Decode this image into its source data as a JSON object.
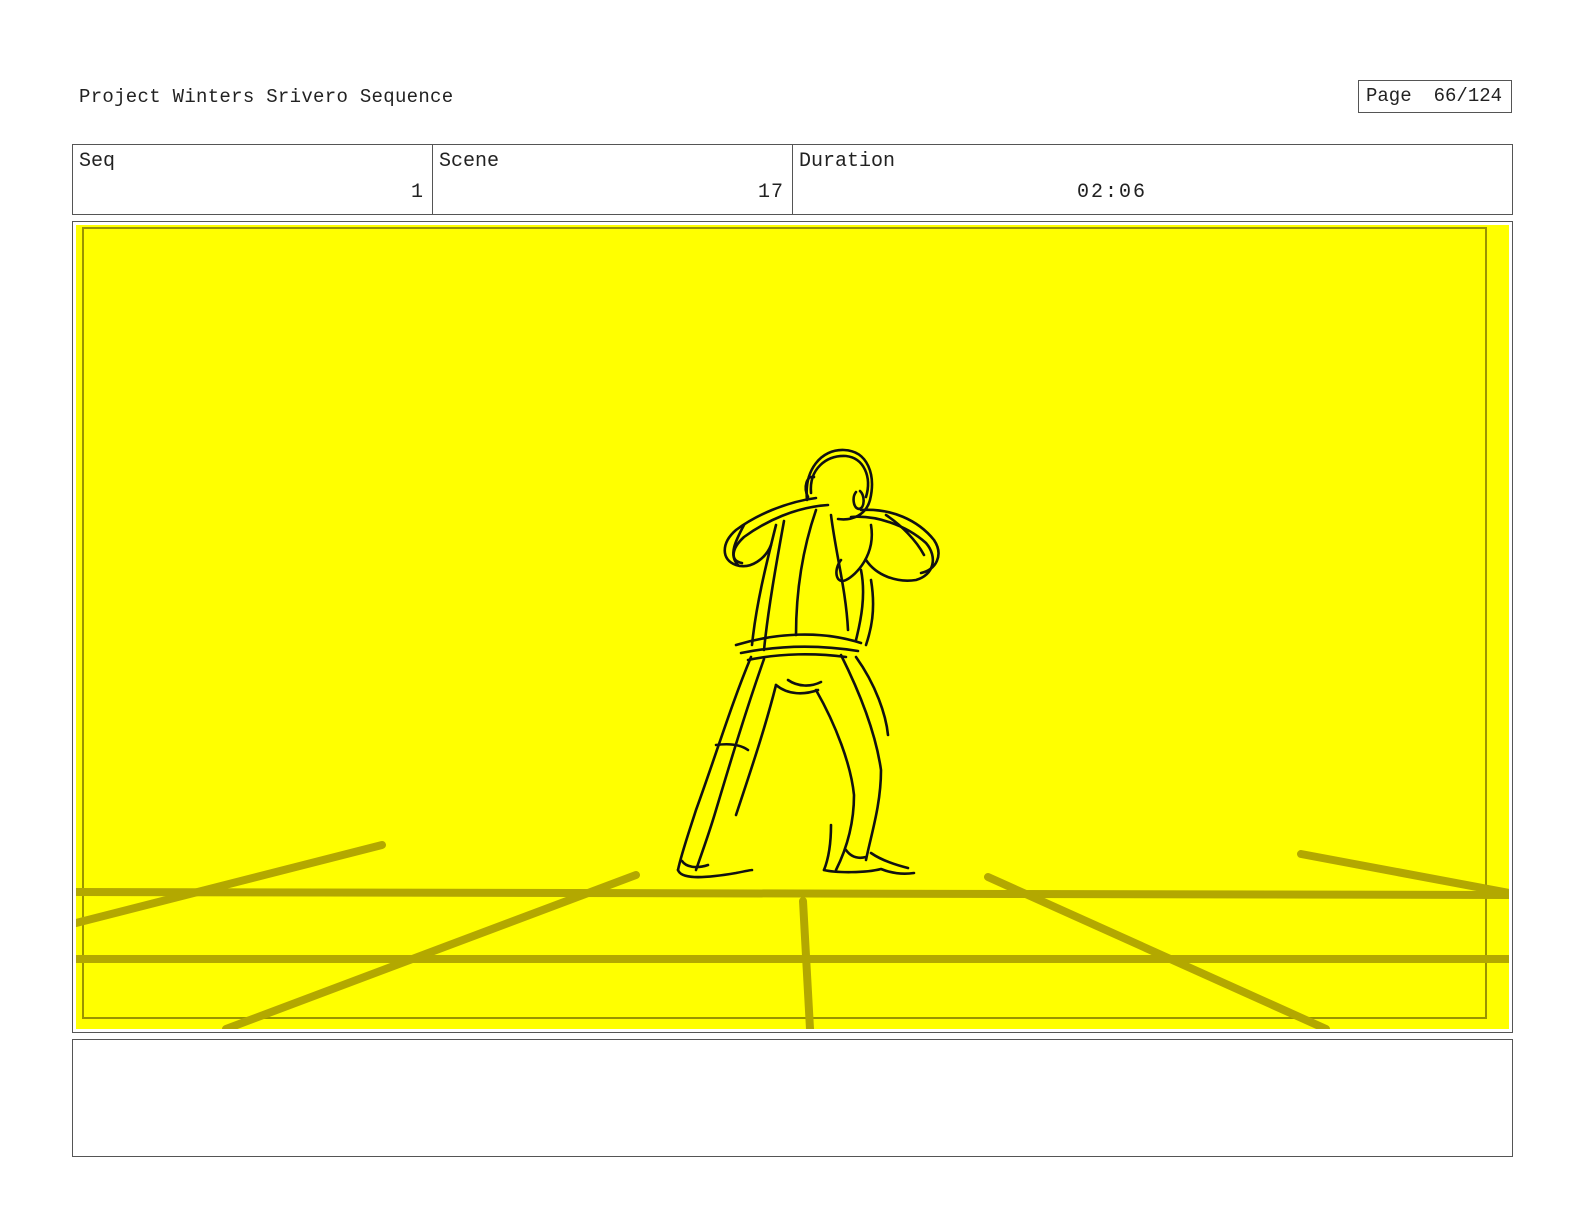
{
  "header": {
    "project_title": "Project Winters Srivero Sequence",
    "page_label": "Page",
    "page_number": "66/124"
  },
  "info": {
    "seq_label": "Seq",
    "seq_value": "1",
    "scene_label": "Scene",
    "scene_value": "17",
    "duration_label": "Duration",
    "duration_value": "02:06"
  },
  "panel": {
    "background_color": "#ffff00",
    "floor_line_color": "#b3a800",
    "sketch_color": "#111111"
  },
  "notes": {
    "text": ""
  }
}
